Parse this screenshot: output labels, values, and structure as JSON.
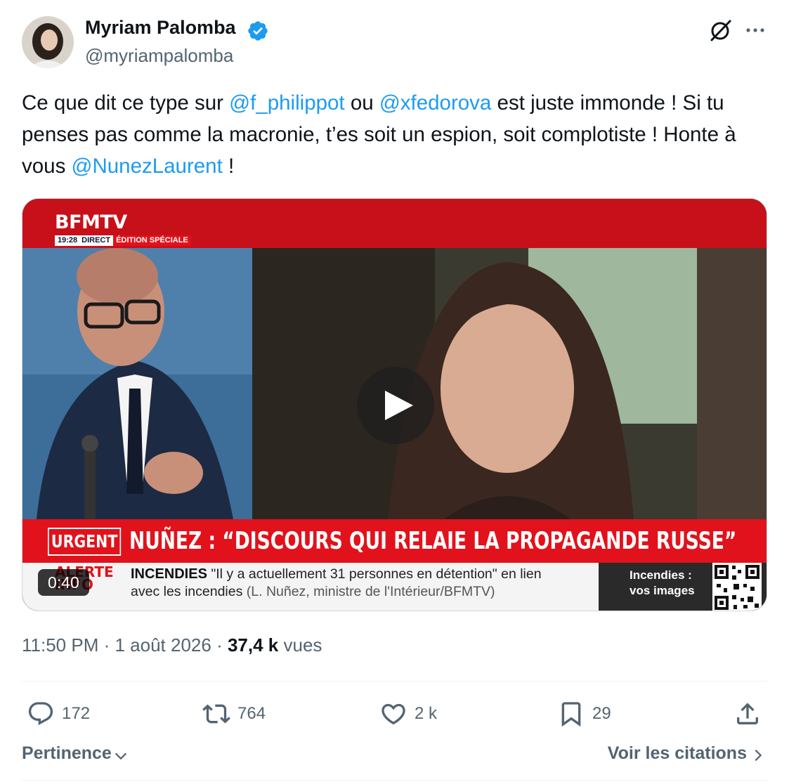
{
  "author": {
    "name": "Myriam Palomba",
    "handle": "@myriampalomba",
    "verified": true
  },
  "header_icons": [
    "grok-icon",
    "more-icon"
  ],
  "tweet": {
    "segments": [
      {
        "text": "Ce que dit ce type sur ",
        "type": "text"
      },
      {
        "text": "@f_philippot",
        "type": "mention"
      },
      {
        "text": " ou ",
        "type": "text"
      },
      {
        "text": "@xfedorova",
        "type": "mention"
      },
      {
        "text": " est juste immonde ! Si tu penses pas comme la macronie, t’es soit un espion, soit complotiste ! Honte à vous ",
        "type": "text"
      },
      {
        "text": "@NunezLaurent",
        "type": "mention"
      },
      {
        "text": " !",
        "type": "text"
      }
    ]
  },
  "video": {
    "channel": "BFMTV",
    "time": "19:28",
    "live": "DIRECT",
    "edition": "ÉDITION SPÉCIALE",
    "urgent_label": "URGENT",
    "headline": "NUÑEZ : “DISCOURS QUI RELAIE LA PROPAGANDE RUSSE”",
    "alert_label": "ALERTE INFO",
    "ticker_topic": "INCENDIES",
    "ticker_line1": " \"Il y a actuellement 31 personnes en détention\" en lien",
    "ticker_line2": "avec les incendies ",
    "ticker_source": "(L. Nuñez, ministre de l'Intérieur/BFMTV)",
    "side_line1": "Incendies :",
    "side_line2": "vos images",
    "duration": "0:40"
  },
  "meta": {
    "time": "11:50 PM",
    "date": "1 août 2026",
    "views": "37,4 k",
    "views_label": "vues"
  },
  "actions": {
    "replies": "172",
    "reposts": "764",
    "likes": "2 k",
    "bookmarks": "29"
  },
  "footer": {
    "sort_label": "Pertinence",
    "quotes_label": "Voir les citations"
  },
  "colors": {
    "accent": "#1d9bf0",
    "text": "#0f1419",
    "secondary": "#536471",
    "bfm_red": "#e1121b"
  }
}
